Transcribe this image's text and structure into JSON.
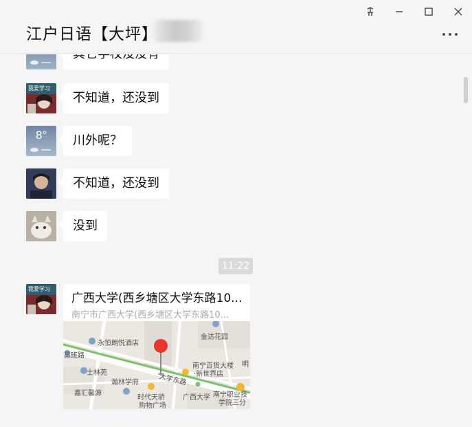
{
  "window": {
    "title": "江户日语【大坪】",
    "pin_glyph": "⊼",
    "minimize_glyph": "—",
    "maximize_glyph": "☐",
    "close_glyph": "✕"
  },
  "messages": [
    {
      "text": "其它学校没没有",
      "avatar": "weather-avatar"
    },
    {
      "text": "不知道，还没到",
      "avatar": "study-avatar",
      "avatar_label": "我爱学习"
    },
    {
      "text": "川外呢？",
      "avatar": "weather-avatar",
      "avatar_label": "8°"
    },
    {
      "text": "不知道，还没到",
      "avatar": "person-avatar"
    },
    {
      "text": "没到",
      "avatar": "cat-avatar"
    }
  ],
  "timestamp": "11:22",
  "location": {
    "avatar_label": "我爱学习",
    "title": "广西大学(西乡塘区大学东路10...",
    "address": "南宁市广西大学(西乡塘区大学东路10...",
    "map_labels": {
      "hotel": "永恒朗悦酒店",
      "garden": "金达花园",
      "road_left": "邕班路",
      "shilinyuan": "士林苑",
      "hanlin": "瀚林学府",
      "jiahui": "嘉汇馨源",
      "shidai": "时代天骄",
      "shidai2": "购物广场",
      "university": "广西大学",
      "road_main": "大学东路",
      "baihuo": "南宁百货大楼",
      "baihuo2": "·新世界店",
      "zhiye": "南宁职业技",
      "zhiye2": "学院三分",
      "ming": "明"
    },
    "colors": {
      "pin": "#e8352e",
      "metro": "#7cc26b",
      "poi": "#f3b632"
    }
  }
}
